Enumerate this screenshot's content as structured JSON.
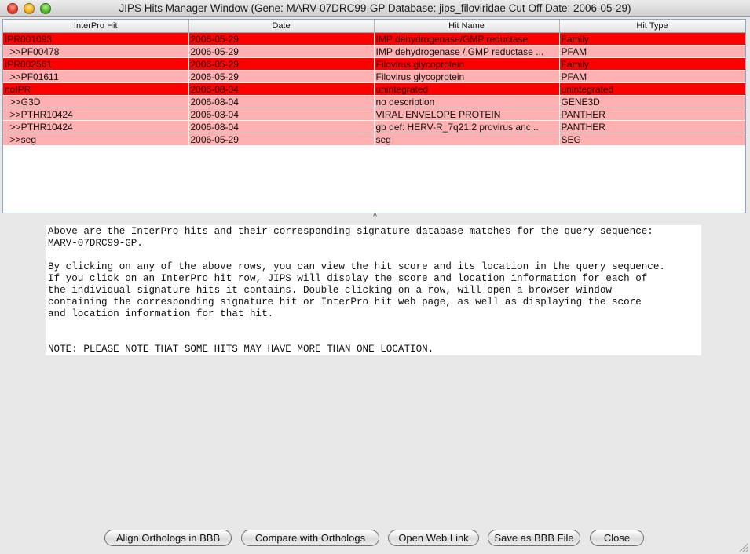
{
  "window": {
    "title": "JIPS Hits Manager Window (Gene: MARV-07DRC99-GP Database: jips_filoviridae Cut Off Date: 2006-05-29)"
  },
  "table": {
    "columns": [
      "InterPro Hit",
      "Date",
      "Hit Name",
      "Hit Type"
    ],
    "rows": [
      {
        "kind": "interpro",
        "hit": "IPR001093",
        "date": "2006-05-29",
        "name": "IMP dehydrogenase/GMP reductase",
        "type": "Family"
      },
      {
        "kind": "sig",
        "hit": "  >>PF00478",
        "date": "2006-05-29",
        "name": "IMP dehydrogenase / GMP reductase ...",
        "type": "PFAM"
      },
      {
        "kind": "interpro",
        "hit": "IPR002561",
        "date": "2006-05-29",
        "name": "Filovirus glycoprotein",
        "type": "Family"
      },
      {
        "kind": "sig",
        "hit": "  >>PF01611",
        "date": "2006-05-29",
        "name": "Filovirus glycoprotein",
        "type": "PFAM"
      },
      {
        "kind": "interpro",
        "hit": "noIPR",
        "date": "2006-08-04",
        "name": "unintegrated",
        "type": "unintegrated"
      },
      {
        "kind": "sig",
        "hit": "  >>G3D",
        "date": "2006-08-04",
        "name": "no description",
        "type": "GENE3D"
      },
      {
        "kind": "sig",
        "hit": "  >>PTHR10424",
        "date": "2006-08-04",
        "name": "VIRAL ENVELOPE PROTEIN",
        "type": "PANTHER"
      },
      {
        "kind": "sig",
        "hit": "  >>PTHR10424",
        "date": "2006-08-04",
        "name": "gb def: HERV-R_7q21.2 provirus anc...",
        "type": "PANTHER"
      },
      {
        "kind": "sig",
        "hit": "  >>seg",
        "date": "2006-05-29",
        "name": "seg",
        "type": "SEG"
      }
    ]
  },
  "splitter": {
    "glyph": "^"
  },
  "info": {
    "text": "Above are the InterPro hits and their corresponding signature database matches for the query sequence:\nMARV-07DRC99-GP.\n\nBy clicking on any of the above rows, you can view the hit score and its location in the query sequence.\nIf you click on an InterPro hit row, JIPS will display the score and location information for each of\nthe individual signature hits it contains. Double-clicking on a row, will open a browser window\ncontaining the corresponding signature hit or InterPro hit web page, as well as displaying the score\nand location information for that hit.\n\n\nNOTE: PLEASE NOTE THAT SOME HITS MAY HAVE MORE THAN ONE LOCATION."
  },
  "buttons": {
    "align": "Align Orthologs in BBB",
    "compare": "Compare with Orthologs",
    "weblink": "Open Web Link",
    "save": "Save as BBB File",
    "close": "Close"
  },
  "colors": {
    "interpro_row": "#ff0000",
    "signature_row": "#ffb0b0"
  }
}
